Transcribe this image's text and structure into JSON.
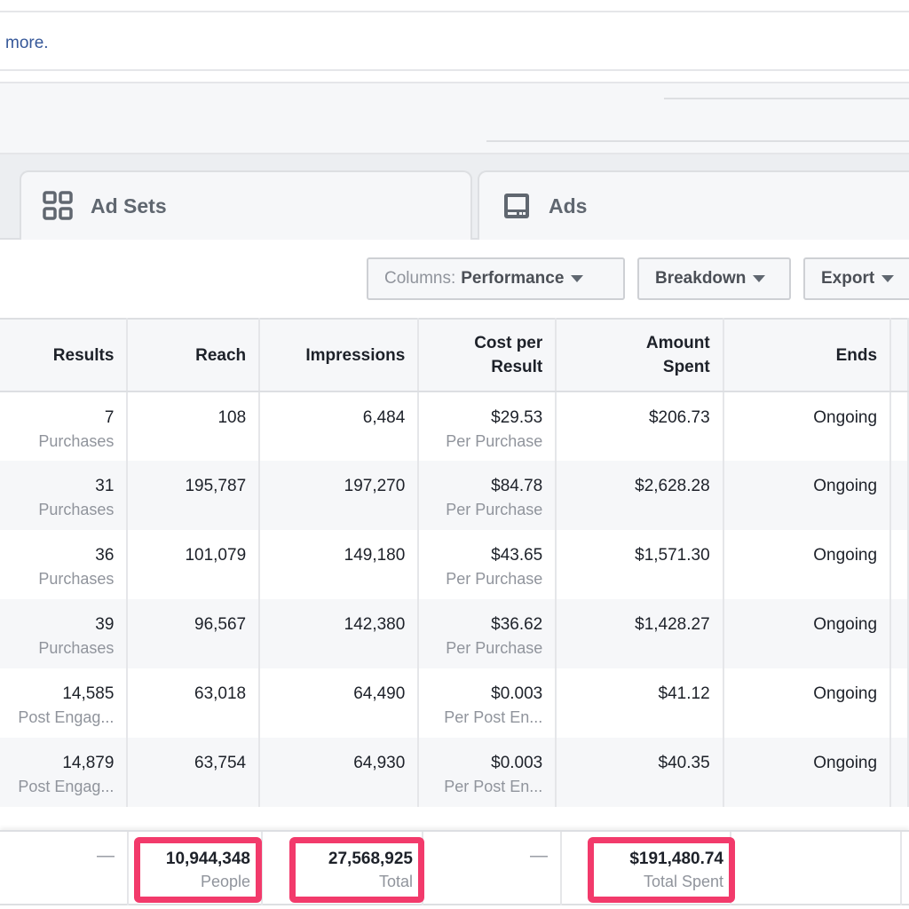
{
  "banner": {
    "link_text": "more."
  },
  "tabs": [
    {
      "label": "Ad Sets",
      "icon": "grid-icon"
    },
    {
      "label": "Ads",
      "icon": "ad-icon"
    }
  ],
  "toolbar": {
    "columns_label": "Columns:",
    "columns_value": "Performance",
    "breakdown": "Breakdown",
    "export": "Export"
  },
  "table": {
    "headers": [
      "Results",
      "Reach",
      "Impressions",
      "Cost per Result",
      "Amount Spent",
      "Ends"
    ],
    "rows": [
      {
        "results": "7",
        "results_type": "Purchases",
        "reach": "108",
        "impressions": "6,484",
        "cost": "$29.53",
        "cost_type": "Per Purchase",
        "spent": "$206.73",
        "ends": "Ongoing"
      },
      {
        "results": "31",
        "results_type": "Purchases",
        "reach": "195,787",
        "impressions": "197,270",
        "cost": "$84.78",
        "cost_type": "Per Purchase",
        "spent": "$2,628.28",
        "ends": "Ongoing"
      },
      {
        "results": "36",
        "results_type": "Purchases",
        "reach": "101,079",
        "impressions": "149,180",
        "cost": "$43.65",
        "cost_type": "Per Purchase",
        "spent": "$1,571.30",
        "ends": "Ongoing"
      },
      {
        "results": "39",
        "results_type": "Purchases",
        "reach": "96,567",
        "impressions": "142,380",
        "cost": "$36.62",
        "cost_type": "Per Purchase",
        "spent": "$1,428.27",
        "ends": "Ongoing"
      },
      {
        "results": "14,585",
        "results_type": "Post Engag...",
        "reach": "63,018",
        "impressions": "64,490",
        "cost": "$0.003",
        "cost_type": "Per Post En...",
        "spent": "$41.12",
        "ends": "Ongoing"
      },
      {
        "results": "14,879",
        "results_type": "Post Engag...",
        "reach": "63,754",
        "impressions": "64,930",
        "cost": "$0.003",
        "cost_type": "Per Post En...",
        "spent": "$40.35",
        "ends": "Ongoing"
      }
    ]
  },
  "totals": {
    "results": "—",
    "reach": "10,944,348",
    "reach_label": "People",
    "impressions": "27,568,925",
    "impressions_label": "Total",
    "cost": "—",
    "spent": "$191,480.74",
    "spent_label": "Total Spent"
  },
  "colors": {
    "highlight": "#f23a6b",
    "link": "#365899"
  }
}
